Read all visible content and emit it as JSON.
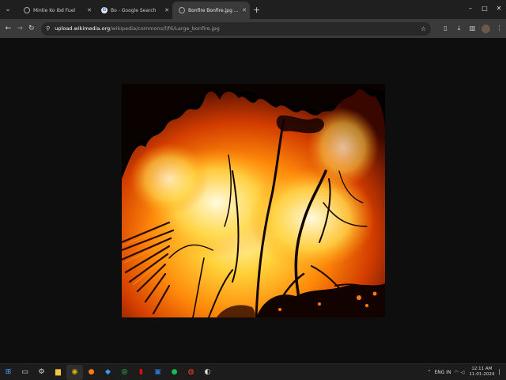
{
  "browser": {
    "tabs": [
      {
        "title": "Mintie Ko Ibd Fuel",
        "favicon": "globe-icon",
        "active": false
      },
      {
        "title": "Bo - Google Search",
        "favicon": "google-icon",
        "active": false
      },
      {
        "title": "Bonfire Bonfire.jpg (JPEG Image, ...)",
        "favicon": "image-icon",
        "active": true
      }
    ],
    "new_tab": "+",
    "window_controls": [
      "–",
      "□",
      "✕"
    ],
    "address": {
      "host": "upload.wikimedia.org",
      "path": "/wikipedia/commons/f/f6/Large_bonfire.jpg"
    }
  },
  "page": {
    "image_name": "bonfire-image"
  },
  "taskbar": {
    "apps": [
      "start-icon",
      "search-icon",
      "settings-icon",
      "file-explorer-icon",
      "chrome-icon",
      "firefox-icon",
      "vscode-icon",
      "whatsapp-icon",
      "netflix-icon",
      "word-icon",
      "spotify-icon",
      "recorder-icon",
      "chrome-alt-icon"
    ],
    "tray": {
      "lang": "ENG IN",
      "time": "12:11 AM",
      "date": "11-01-2024"
    }
  }
}
